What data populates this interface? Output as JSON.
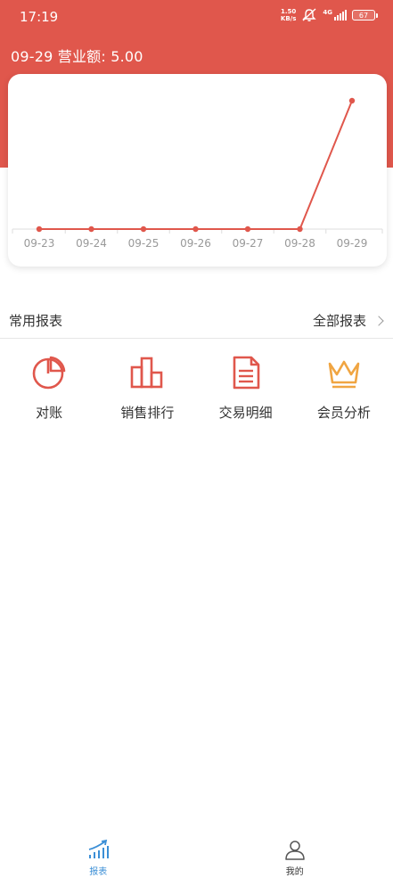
{
  "status_bar": {
    "time": "17:19",
    "net_speed_value": "1.50",
    "net_speed_unit": "KB/s",
    "network": "4G",
    "battery": "67"
  },
  "header": {
    "summary": "09-29 营业额: 5.00"
  },
  "chart_data": {
    "type": "line",
    "categories": [
      "09-23",
      "09-24",
      "09-25",
      "09-26",
      "09-27",
      "09-28",
      "09-29"
    ],
    "values": [
      0,
      0,
      0,
      0,
      0,
      0,
      5.0
    ],
    "title": "",
    "xlabel": "",
    "ylabel": "",
    "color": "#e0574c"
  },
  "section": {
    "title": "常用报表",
    "more_label": "全部报表"
  },
  "shortcuts": [
    {
      "label": "对账",
      "icon": "pie-chart-icon",
      "color": "#e0574c"
    },
    {
      "label": "销售排行",
      "icon": "bar-chart-icon",
      "color": "#e0574c"
    },
    {
      "label": "交易明细",
      "icon": "document-icon",
      "color": "#e0574c"
    },
    {
      "label": "会员分析",
      "icon": "crown-icon",
      "color": "#f0a542"
    }
  ],
  "tabbar": {
    "tabs": [
      {
        "label": "报表",
        "icon": "report-chart-icon",
        "active": true
      },
      {
        "label": "我的",
        "icon": "user-icon",
        "active": false
      }
    ],
    "active_color": "#3c8fd6"
  }
}
